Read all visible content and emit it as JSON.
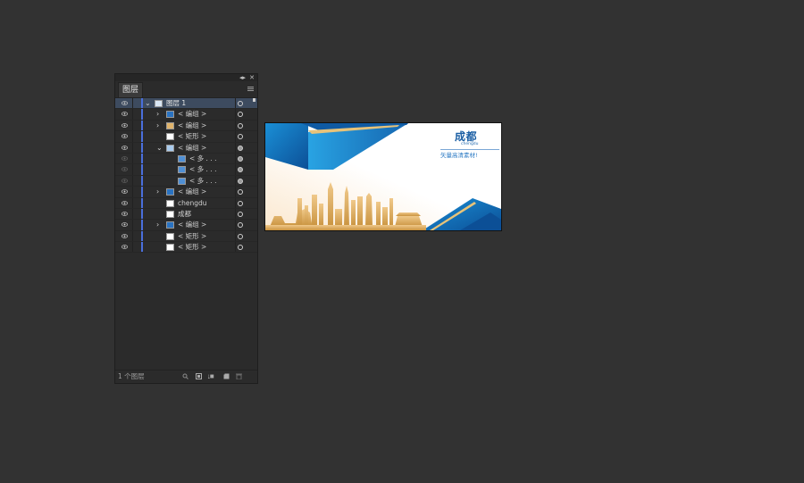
{
  "panel": {
    "tab_label": "图层",
    "collapse_glyph": "◂▸",
    "close_glyph": "✕",
    "footer_count": "1 个图层"
  },
  "layers": [
    {
      "label": "图层 1",
      "indent": 0,
      "expand": "open",
      "selected": true,
      "visible": true,
      "thumb": "mixed",
      "target": "hollow"
    },
    {
      "label": "< 编组 >",
      "indent": 1,
      "expand": "closed",
      "visible": true,
      "thumb": "blue-wave",
      "target": "hollow"
    },
    {
      "label": "< 编组 >",
      "indent": 1,
      "expand": "closed",
      "visible": true,
      "thumb": "gold",
      "target": "hollow"
    },
    {
      "label": "< 矩形 >",
      "indent": 1,
      "expand": "none",
      "visible": true,
      "thumb": "white",
      "target": "hollow"
    },
    {
      "label": "< 编组 >",
      "indent": 1,
      "expand": "open",
      "visible": true,
      "thumb": "blue-light",
      "target": "filled"
    },
    {
      "label": "< 多 . . .",
      "indent": 2,
      "expand": "none",
      "visible": false,
      "thumb": "blue-tri",
      "target": "filled"
    },
    {
      "label": "< 多 . . .",
      "indent": 2,
      "expand": "none",
      "visible": false,
      "thumb": "blue-tri",
      "target": "filled"
    },
    {
      "label": "< 多 . . .",
      "indent": 2,
      "expand": "none",
      "visible": false,
      "thumb": "blue-tri",
      "target": "filled"
    },
    {
      "label": "< 编组 >",
      "indent": 1,
      "expand": "closed",
      "visible": true,
      "thumb": "blue-wave",
      "target": "hollow"
    },
    {
      "label": "chengdu",
      "indent": 1,
      "expand": "none",
      "visible": true,
      "thumb": "text",
      "target": "hollow"
    },
    {
      "label": "成都",
      "indent": 1,
      "expand": "none",
      "visible": true,
      "thumb": "text",
      "target": "hollow"
    },
    {
      "label": "< 编组 >",
      "indent": 1,
      "expand": "closed",
      "visible": true,
      "thumb": "blue-wave",
      "target": "hollow"
    },
    {
      "label": "< 矩形 >",
      "indent": 1,
      "expand": "none",
      "visible": true,
      "thumb": "white",
      "target": "hollow"
    },
    {
      "label": "< 矩形 >",
      "indent": 1,
      "expand": "none",
      "visible": true,
      "thumb": "white",
      "target": "hollow"
    }
  ],
  "artboard": {
    "title": "成都",
    "subtitle": "chengdu",
    "tagline": "矢量高清素材!"
  },
  "colors": {
    "app_bg": "#323232",
    "panel_bg": "#2b2b2b",
    "selected_row": "#3d4b5f",
    "layer_color": "#4a6fdc",
    "art_blue": "#1b6fb8",
    "art_gold": "#d4a65a"
  }
}
